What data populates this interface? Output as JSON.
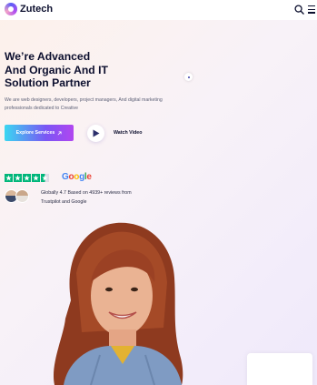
{
  "header": {
    "brand": "Zutech",
    "logo_icon": "zutech-logo-icon",
    "search_icon": "search-icon",
    "menu_icon": "hamburger-menu-icon"
  },
  "hero": {
    "title_lines": [
      "We’re Advanced",
      "And Organic And IT",
      "Solution Partner"
    ],
    "description": "We are web designers, developers, project managers, And digital marketing professionals dedicated to Creative",
    "explore_button": "Explore Services",
    "explore_icon": "arrow-up-right-icon",
    "watch_label": "Watch Video",
    "play_icon": "play-icon"
  },
  "reviews": {
    "trustpilot_stars": 4.5,
    "star_color": "#00b67a",
    "google_label": "Google",
    "text": "Globally 4.7 Based on 4939+ reviews from Trustpilot and Google"
  },
  "colors": {
    "title": "#0c0f2e",
    "button_gradient_start": "#3ad7f1",
    "button_gradient_end": "#b146f0"
  }
}
